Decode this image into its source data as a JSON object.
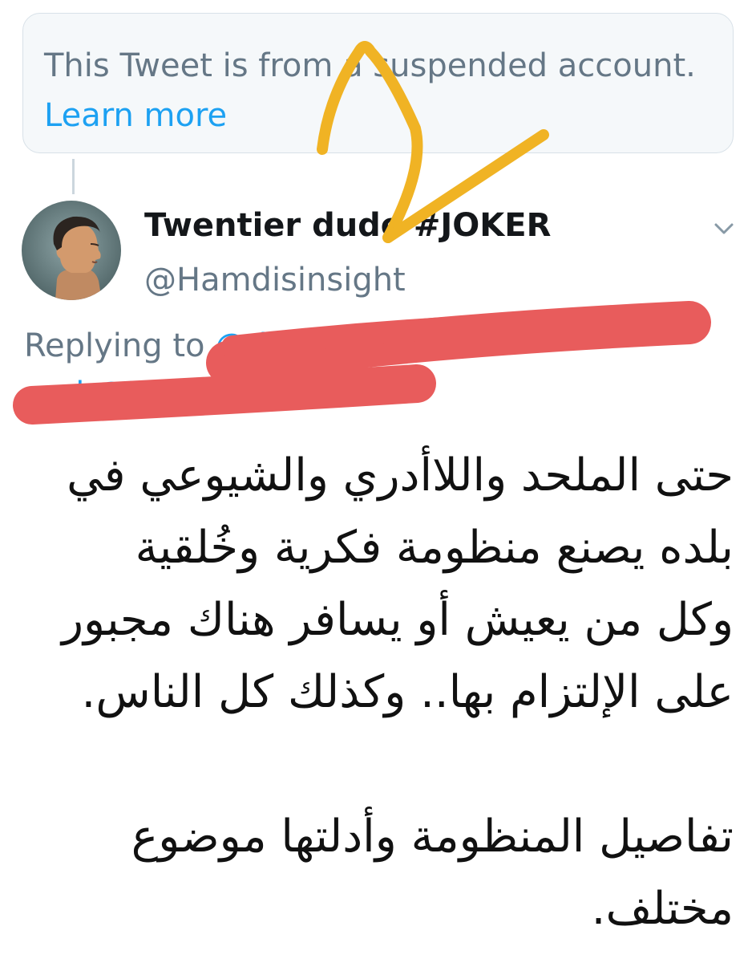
{
  "notice": {
    "text": "This Tweet is from a suspended account.",
    "link_label": "Learn more"
  },
  "author": {
    "display_name": "Twentier dude #JOKER",
    "handle": "@Hamdisinsight",
    "avatar_icon": "profile-portrait"
  },
  "reply": {
    "prefix": "Replying to",
    "mentions_line1": "@dark1",
    "mentions_line2": "and @N"
  },
  "tweet": {
    "paragraph1": [
      "حتى الملحد واللاأدري والشيوعي في",
      "بلده يصنع منظومة فكرية وخُلقية",
      "وكل من يعيش أو يسافر هناك مجبور",
      "على الإلتزام بها.. وكذلك كل الناس."
    ],
    "paragraph2": [
      "تفاصيل المنظومة وأدلتها موضوع",
      "مختلف."
    ]
  },
  "colors": {
    "link": "#1da1f2",
    "muted": "#657786",
    "redaction": "#e85c5c",
    "annotation": "#f0b324"
  }
}
